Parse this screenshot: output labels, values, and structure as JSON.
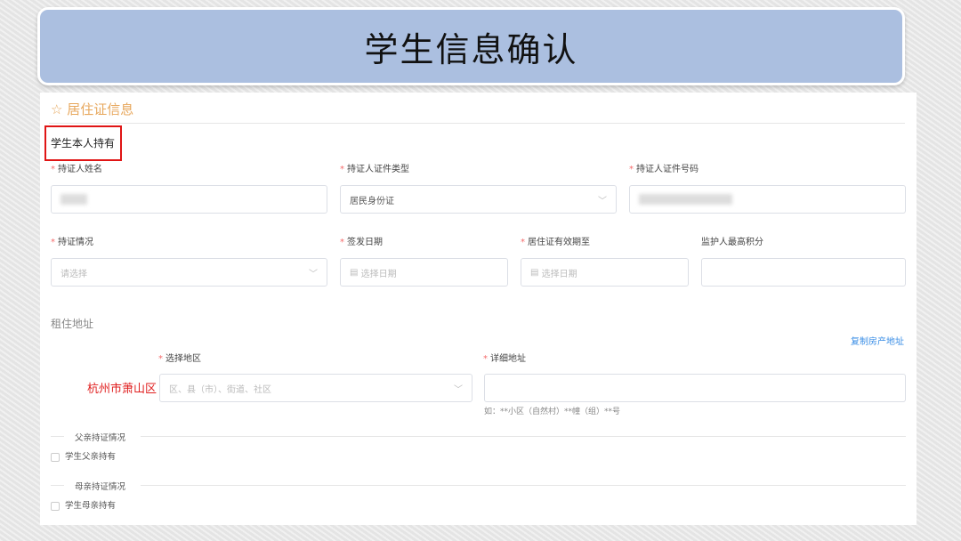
{
  "title": "学生信息确认",
  "section": {
    "icon": "star-outline-icon",
    "title": "居住证信息",
    "subtitle": "学生本人持有"
  },
  "fields": {
    "holder_name": {
      "label": "持证人姓名",
      "required": true
    },
    "id_type": {
      "label": "持证人证件类型",
      "required": true,
      "value": "居民身份证"
    },
    "id_number": {
      "label": "持证人证件号码",
      "required": true
    },
    "status": {
      "label": "持证情况",
      "required": true,
      "placeholder": "请选择"
    },
    "issue_date": {
      "label": "签发日期",
      "required": true,
      "placeholder": "选择日期"
    },
    "valid_until": {
      "label": "居住证有效期至",
      "required": true,
      "placeholder": "选择日期"
    },
    "guardian_points": {
      "label": "监护人最高积分",
      "required": false
    }
  },
  "address": {
    "title": "租住地址",
    "copy_link": "复制房产地址",
    "region_label": "选择地区",
    "region_annotation": "杭州市萧山区",
    "region_placeholder": "区、县（市）、街道、社区",
    "detail_label": "详细地址",
    "detail_hint": "如：**小区（自然村）**幢（组）**号"
  },
  "father": {
    "title": "父亲持证情况",
    "checkbox": "学生父亲持有"
  },
  "mother": {
    "title": "母亲持证情况",
    "checkbox": "学生母亲持有"
  },
  "req_mark": "*",
  "colors": {
    "banner": "#abbfe0",
    "accent": "#e7a75c",
    "highlight": "#e01515",
    "link": "#3a8ee6"
  }
}
